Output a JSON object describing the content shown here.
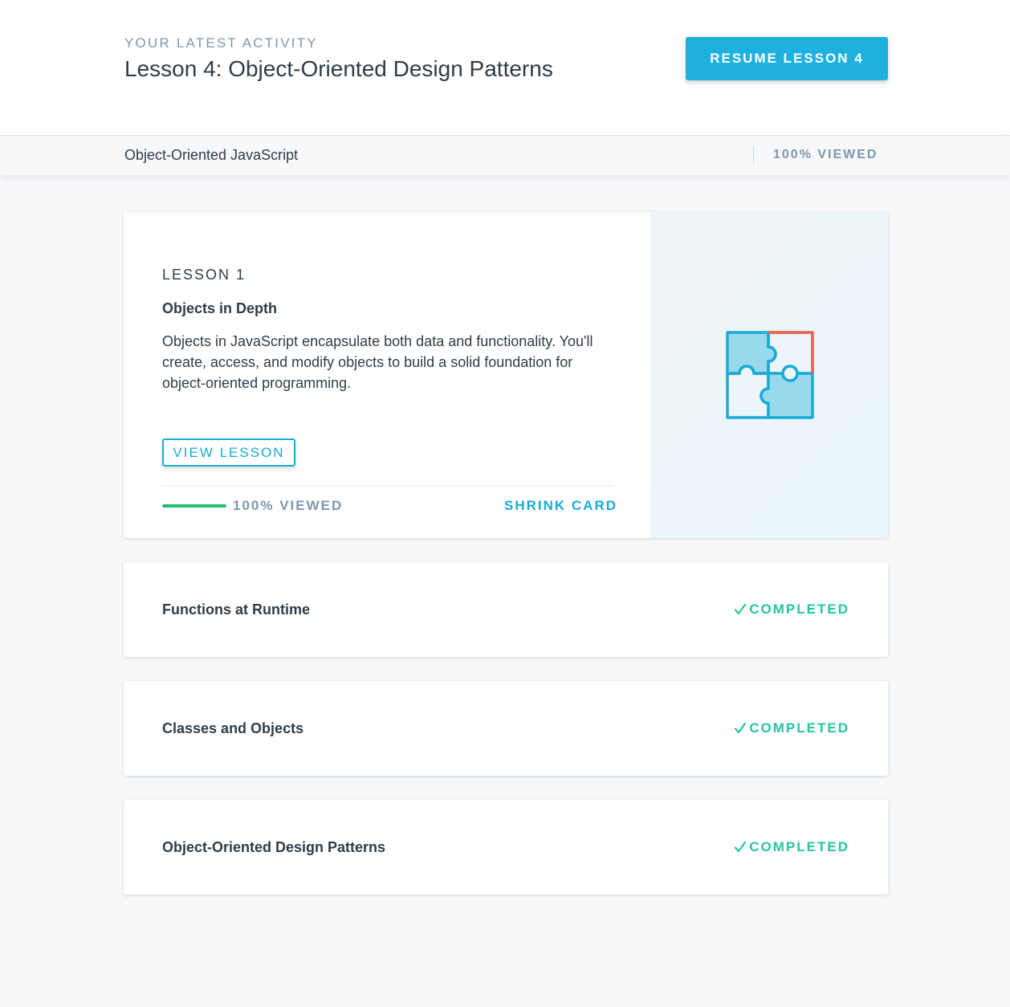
{
  "header": {
    "eyebrow": "YOUR LATEST ACTIVITY",
    "title": "Lesson 4: Object-Oriented Design Patterns",
    "resume_label": "RESUME LESSON 4"
  },
  "course_bar": {
    "course_name": "Object-Oriented JavaScript",
    "viewed_label": "100% VIEWED"
  },
  "expanded_lesson": {
    "label": "LESSON 1",
    "title": "Objects in Depth",
    "description": "Objects in JavaScript encapsulate both data and functionality. You'll create, access, and modify objects to build a solid foundation for object-oriented programming.",
    "view_label": "VIEW LESSON",
    "progress": 1.0,
    "progress_label": "100% VIEWED",
    "shrink_label": "SHRINK CARD",
    "icon": "puzzle-icon"
  },
  "lessons": [
    {
      "title": "Functions at Runtime",
      "status": "COMPLETED"
    },
    {
      "title": "Classes and Objects",
      "status": "COMPLETED"
    },
    {
      "title": "Object-Oriented Design Patterns",
      "status": "COMPLETED"
    }
  ],
  "colors": {
    "accent": "#1eb1df",
    "progress": "#1dbd72",
    "completed": "#24c5a0",
    "puzzle_fill": "#9ad9ec",
    "puzzle_stroke": "#1aaad8",
    "puzzle_highlight": "#f0624b"
  }
}
